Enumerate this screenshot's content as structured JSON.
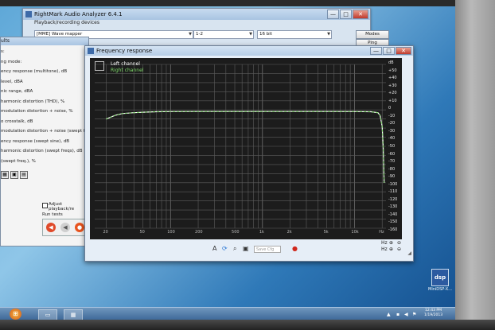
{
  "main_window": {
    "title": "RightMark Audio Analyzer 6.4.1",
    "group_label": "Playback/recording devices",
    "device_select": "[MME] Wave mapper",
    "channel_select": "1-2",
    "bits_select": "16 bit",
    "modes_button": "Modes",
    "ping_button": "Ping",
    "controls": {
      "minimize": "—",
      "maximize": "□",
      "close": "✕"
    }
  },
  "results_window": {
    "title": "ults",
    "rows": [
      "s:",
      "ng mode:",
      "ency response (multitone), dB",
      "level, dBA",
      "nic range, dBA",
      "harmonic distortion (THD), %",
      "modulation distortion + noise, %",
      "o crosstalk, dB",
      "modulation distortion + noise (swept freqs",
      "ency response (swept sine), dB",
      "harmonic distortion (swept freqs), dB",
      "(swept freq.), %"
    ],
    "option_label": "Adjust playback/re",
    "run_label": "Run tests"
  },
  "freq_window": {
    "title": "Frequency response",
    "controls": {
      "minimize": "—",
      "maximize": "□",
      "close": "✕"
    },
    "save_placeholder": "Save Cfg",
    "tool_text": "A",
    "zoom_labels": [
      "Hz",
      "Hz"
    ]
  },
  "chart_data": {
    "type": "line",
    "legend": [
      "Left channel",
      "Right channel"
    ],
    "colors": {
      "left": "#ffffff",
      "right": "#7fdc6a"
    },
    "y_ticks": [
      "dB",
      "+50",
      "+40",
      "+30",
      "+20",
      "+10",
      "0",
      "-10",
      "-20",
      "-30",
      "-40",
      "-50",
      "-60",
      "-70",
      "-80",
      "-90",
      "-100",
      "-110",
      "-120",
      "-130",
      "-140",
      "-150",
      "-160"
    ],
    "ylim": [
      -160,
      20
    ],
    "x_ticks": [
      "20",
      "50",
      "100",
      "200",
      "500",
      "1k",
      "2k",
      "5k",
      "10k",
      "Hz"
    ],
    "x": [
      20,
      25,
      30,
      40,
      50,
      70,
      100,
      200,
      500,
      1000,
      2000,
      5000,
      10000,
      15000,
      18000,
      19000,
      20000,
      20500,
      21000
    ],
    "series": [
      {
        "name": "Left channel",
        "values": [
          -40,
          -36,
          -34,
          -33,
          -32.5,
          -32,
          -31.8,
          -31.7,
          -31.7,
          -31.7,
          -31.7,
          -31.7,
          -31.8,
          -32,
          -33,
          -36,
          -48,
          -70,
          -110
        ]
      },
      {
        "name": "Right channel",
        "values": [
          -40,
          -36,
          -34,
          -33,
          -32.5,
          -32,
          -31.8,
          -31.7,
          -31.7,
          -31.7,
          -31.7,
          -31.7,
          -31.8,
          -32,
          -33,
          -36,
          -48,
          -70,
          -110
        ]
      }
    ],
    "grid": true
  },
  "desktop": {
    "icon_name": "dsp",
    "icon_label": "MiniDSP-X..."
  },
  "taskbar": {
    "start_icon": "windows-orb",
    "clock_time": "12:43 PM",
    "clock_date": "1/19/2013"
  }
}
